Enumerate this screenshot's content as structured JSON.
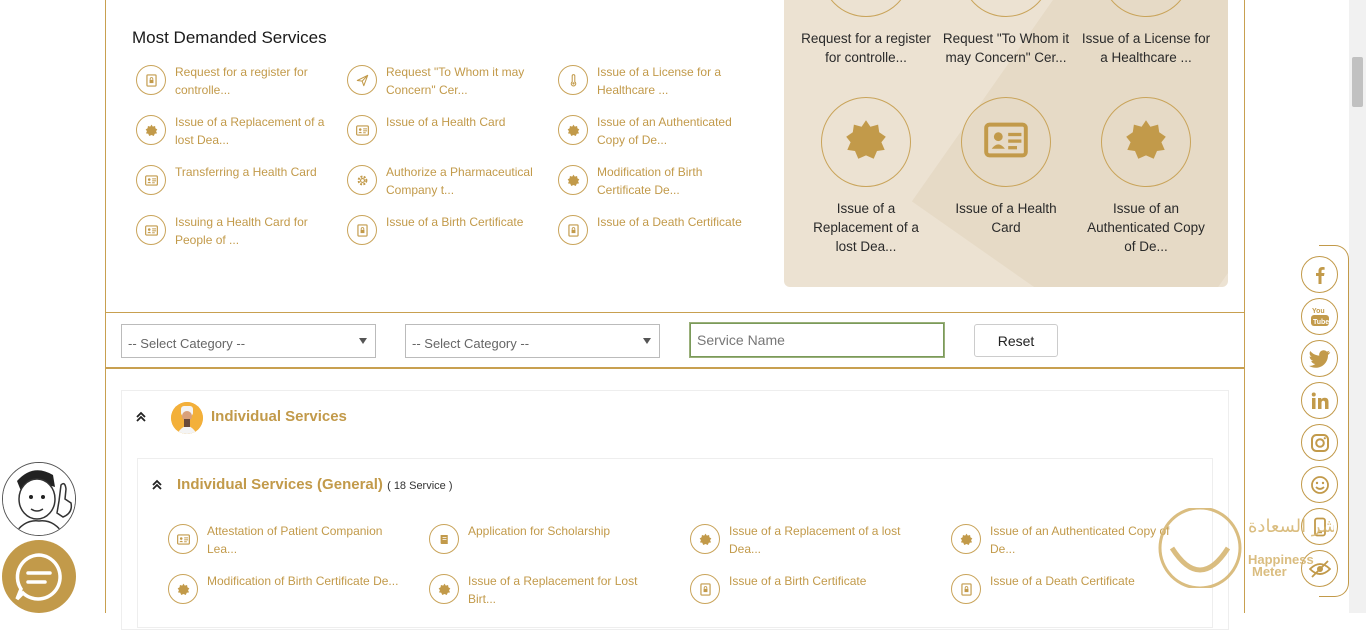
{
  "most_demanded": {
    "title": "Most Demanded Services",
    "items": [
      {
        "label": "Request for a register for controlle...",
        "icon": "doc-lock-icon"
      },
      {
        "label": "Request \"To Whom it may Concern\" Cer...",
        "icon": "send-icon"
      },
      {
        "label": "Issue of a License for a Healthcare ...",
        "icon": "thermometer-icon"
      },
      {
        "label": "Issue of a Replacement of a lost Dea...",
        "icon": "seal-icon"
      },
      {
        "label": "Issue of a Health Card",
        "icon": "id-card-icon"
      },
      {
        "label": "Issue of an Authenticated Copy of De...",
        "icon": "seal-icon"
      },
      {
        "label": "Transferring a Health Card",
        "icon": "id-card-icon"
      },
      {
        "label": "Authorize a Pharmaceutical Company t...",
        "icon": "gear-icon"
      },
      {
        "label": "Modification of Birth Certificate De...",
        "icon": "seal-icon"
      },
      {
        "label": "Issuing a Health Card for People of ...",
        "icon": "id-card-icon"
      },
      {
        "label": "Issue of a Birth Certificate",
        "icon": "doc-lock-icon"
      },
      {
        "label": "Issue of a Death Certificate",
        "icon": "doc-lock-icon"
      }
    ]
  },
  "panel": {
    "top_row": [
      "Request for a register for controlle...",
      "Request \"To Whom it may Concern\" Cer...",
      "Issue of a License for a Healthcare ..."
    ],
    "bottom_row": [
      {
        "label": "Issue of a Replacement of a lost Dea...",
        "icon": "seal-icon"
      },
      {
        "label": "Issue of a Health Card",
        "icon": "id-card-icon"
      },
      {
        "label": "Issue of an Authenticated Copy of De...",
        "icon": "seal-icon"
      }
    ]
  },
  "filters": {
    "category1": "-- Select Category --",
    "category2": "-- Select Category --",
    "search_placeholder": "Service Name",
    "reset_label": "Reset"
  },
  "groups": {
    "individual": "Individual Services",
    "general": "Individual Services (General)",
    "general_count": "( 18 Service )",
    "services": [
      {
        "label": "Attestation of Patient Companion Lea...",
        "icon": "id-card-icon"
      },
      {
        "label": "Application for Scholarship",
        "icon": "book-icon"
      },
      {
        "label": "Issue of a Replacement of a lost Dea...",
        "icon": "seal-icon"
      },
      {
        "label": "Issue of an Authenticated Copy of De...",
        "icon": "seal-icon"
      },
      {
        "label": "Modification of Birth Certificate De...",
        "icon": "seal-icon"
      },
      {
        "label": "Issue of a Replacement for Lost Birt...",
        "icon": "seal-icon"
      },
      {
        "label": "Issue of a Birth Certificate",
        "icon": "doc-lock-icon"
      },
      {
        "label": "Issue of a Death Certificate",
        "icon": "doc-lock-icon"
      }
    ]
  },
  "social": [
    "facebook-icon",
    "youtube-icon",
    "twitter-icon",
    "linkedin-icon",
    "instagram-icon",
    "smiley-icon",
    "phone-icon",
    "eye-icon"
  ],
  "happiness": {
    "arabic": "مؤشر السعادة",
    "english1": "Happiness",
    "english2": "Meter"
  },
  "colors": {
    "gold": "#c29a4a",
    "panel": "#ece2d2"
  }
}
